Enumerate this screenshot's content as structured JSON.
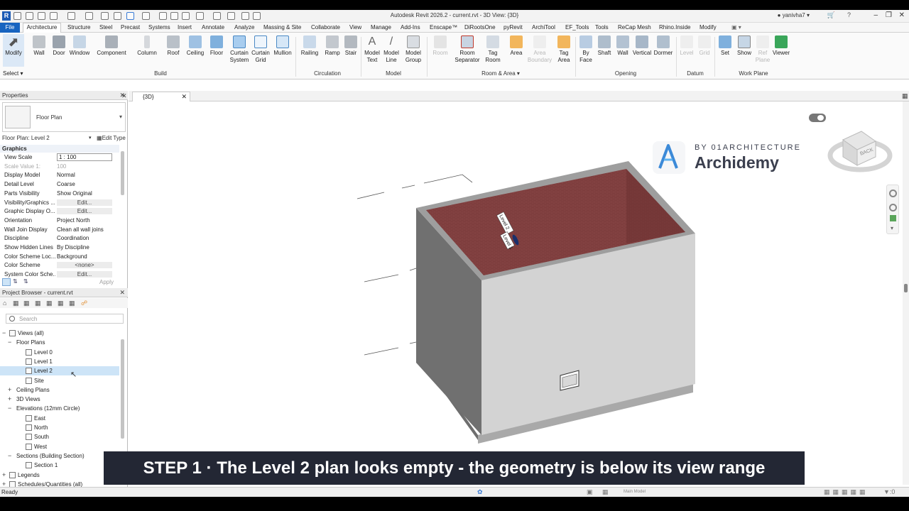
{
  "window": {
    "title": "Autodesk Revit 2026.2 - current.rvt - 3D View: {3D}",
    "user": "yanivha7"
  },
  "menu": {
    "file": "File",
    "active": "Architecture",
    "tabs": [
      "Structure",
      "Steel",
      "Precast",
      "Systems",
      "Insert",
      "Annotate",
      "Analyze",
      "Massing & Site",
      "Collaborate",
      "View",
      "Manage",
      "Add-Ins",
      "Enscape™",
      "DiRootsOne",
      "pyRevit",
      "ArchiTool",
      "EF_Tools",
      "Tools",
      "ReCap Mesh",
      "Rhino.Inside",
      "Modify"
    ]
  },
  "ribbon": {
    "select_label": "Select",
    "groups": {
      "build": "Build",
      "circulation": "Circulation",
      "model": "Model",
      "room_area": "Room & Area",
      "opening": "Opening",
      "datum": "Datum",
      "work_plane": "Work Plane"
    },
    "tools": {
      "modify": "Modify",
      "wall": "Wall",
      "door": "Door",
      "window": "Window",
      "component": "Component",
      "column": "Column",
      "roof": "Roof",
      "ceiling": "Ceiling",
      "floor": "Floor",
      "curtain_system": "Curtain System",
      "curtain_grid": "Curtain Grid",
      "mullion": "Mullion",
      "railing": "Railing",
      "ramp": "Ramp",
      "stair": "Stair",
      "model_text": "Model Text",
      "model_line": "Model Line",
      "model_group": "Model Group",
      "room": "Room",
      "room_separator": "Room Separator",
      "tag_room": "Tag Room",
      "area": "Area",
      "area_boundary": "Area Boundary",
      "tag_area": "Tag Area",
      "by_face": "By Face",
      "shaft": "Shaft",
      "op_wall": "Wall",
      "vertical": "Vertical",
      "dormer": "Dormer",
      "level": "Level",
      "grid": "Grid",
      "set": "Set",
      "show": "Show",
      "ref_plane": "Ref Plane",
      "viewer": "Viewer"
    }
  },
  "properties": {
    "header": "Properties",
    "type_name": "Floor Plan",
    "instance": "Floor Plan: Level 2",
    "edit_type": "Edit Type",
    "section": "Graphics",
    "apply": "Apply",
    "rows": [
      {
        "name": "View Scale",
        "value": "1 : 100"
      },
      {
        "name": "Scale Value    1:",
        "value": "100"
      },
      {
        "name": "Display Model",
        "value": "Normal"
      },
      {
        "name": "Detail Level",
        "value": "Coarse"
      },
      {
        "name": "Parts Visibility",
        "value": "Show Original"
      },
      {
        "name": "Visibility/Graphics ...",
        "value": "Edit..."
      },
      {
        "name": "Graphic Display O...",
        "value": "Edit..."
      },
      {
        "name": "Orientation",
        "value": "Project North"
      },
      {
        "name": "Wall Join Display",
        "value": "Clean all wall joins"
      },
      {
        "name": "Discipline",
        "value": "Coordination"
      },
      {
        "name": "Show Hidden Lines",
        "value": "By Discipline"
      },
      {
        "name": "Color Scheme Loc...",
        "value": "Background"
      },
      {
        "name": "Color Scheme",
        "value": "<none>"
      },
      {
        "name": "System Color Sche...",
        "value": "Edit..."
      }
    ]
  },
  "browser": {
    "header": "Project Browser - current.rvt",
    "search_placeholder": "Search",
    "items": [
      {
        "label": "Views (all)"
      },
      {
        "label": "Floor Plans"
      },
      {
        "label": "Level 0"
      },
      {
        "label": "Level 1"
      },
      {
        "label": "Level 2"
      },
      {
        "label": "Site"
      },
      {
        "label": "Ceiling Plans"
      },
      {
        "label": "3D Views"
      },
      {
        "label": "Elevations (12mm Circle)"
      },
      {
        "label": "East"
      },
      {
        "label": "North"
      },
      {
        "label": "South"
      },
      {
        "label": "West"
      },
      {
        "label": "Sections (Building Section)"
      },
      {
        "label": "Section 1"
      },
      {
        "label": "Legends"
      },
      {
        "label": "Schedules/Quantities (all)"
      }
    ]
  },
  "view": {
    "tab_label": "{3D}",
    "level_tag_1": "Level 2",
    "level_tag_2": "Level 1",
    "viewcube_face": "BACK"
  },
  "branding": {
    "sub": "BY 01ARCHITECTURE",
    "name": "Archidemy"
  },
  "status": {
    "text": "Ready",
    "model": "Main Model",
    "filter_count": ":0"
  },
  "caption": {
    "text": "STEP 1  ·  The Level 2 plan looks empty - the geometry is below its view range"
  },
  "colors": {
    "accent": "#1764c0",
    "roof_fill": "#7a3a3a",
    "caption_bg": "#232734",
    "brand": "#3b3f4e",
    "selection": "#cde4f7"
  }
}
